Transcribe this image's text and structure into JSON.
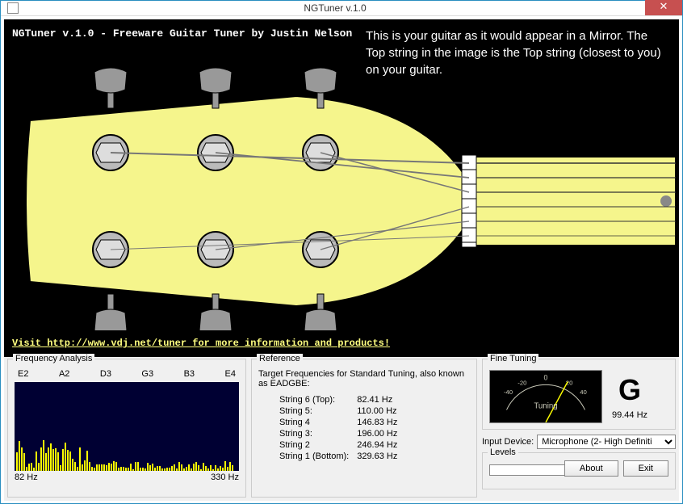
{
  "window": {
    "title": "NGTuner v.1.0"
  },
  "header": {
    "app_title": "NGTuner v.1.0 - Freeware Guitar Tuner by Justin Nelson",
    "mirror_text": "This is your guitar as it would appear in a Mirror. The Top string in the image is the Top string (closest to you) on your guitar.",
    "link": "Visit http://www.vdj.net/tuner for more information and products!"
  },
  "frequency": {
    "title": "Frequency Analysis",
    "notes": [
      "E2",
      "A2",
      "D3",
      "G3",
      "B3",
      "E4"
    ],
    "min_label": "82 Hz",
    "max_label": "330 Hz"
  },
  "reference": {
    "title": "Reference",
    "desc": "Target Frequencies for Standard Tuning, also known as EADGBE:",
    "rows": [
      {
        "label": "String 6 (Top):",
        "hz": "82.41 Hz"
      },
      {
        "label": "String 5:",
        "hz": "110.00 Hz"
      },
      {
        "label": "String 4",
        "hz": "146.83 Hz"
      },
      {
        "label": "String 3:",
        "hz": "196.00 Hz"
      },
      {
        "label": "String 2",
        "hz": "246.94 Hz"
      },
      {
        "label": "String 1 (Bottom):",
        "hz": "329.63 Hz"
      }
    ]
  },
  "fine": {
    "title": "Fine Tuning",
    "meter_label": "Tuning",
    "note": "G",
    "note_hz": "99.44 Hz"
  },
  "input": {
    "label": "Input Device:",
    "value": "Microphone (2- High Definiti"
  },
  "levels": {
    "title": "Levels"
  },
  "buttons": {
    "about": "About",
    "exit": "Exit"
  },
  "colors": {
    "headstock": "#f5f58c",
    "accent": "#c75050"
  }
}
